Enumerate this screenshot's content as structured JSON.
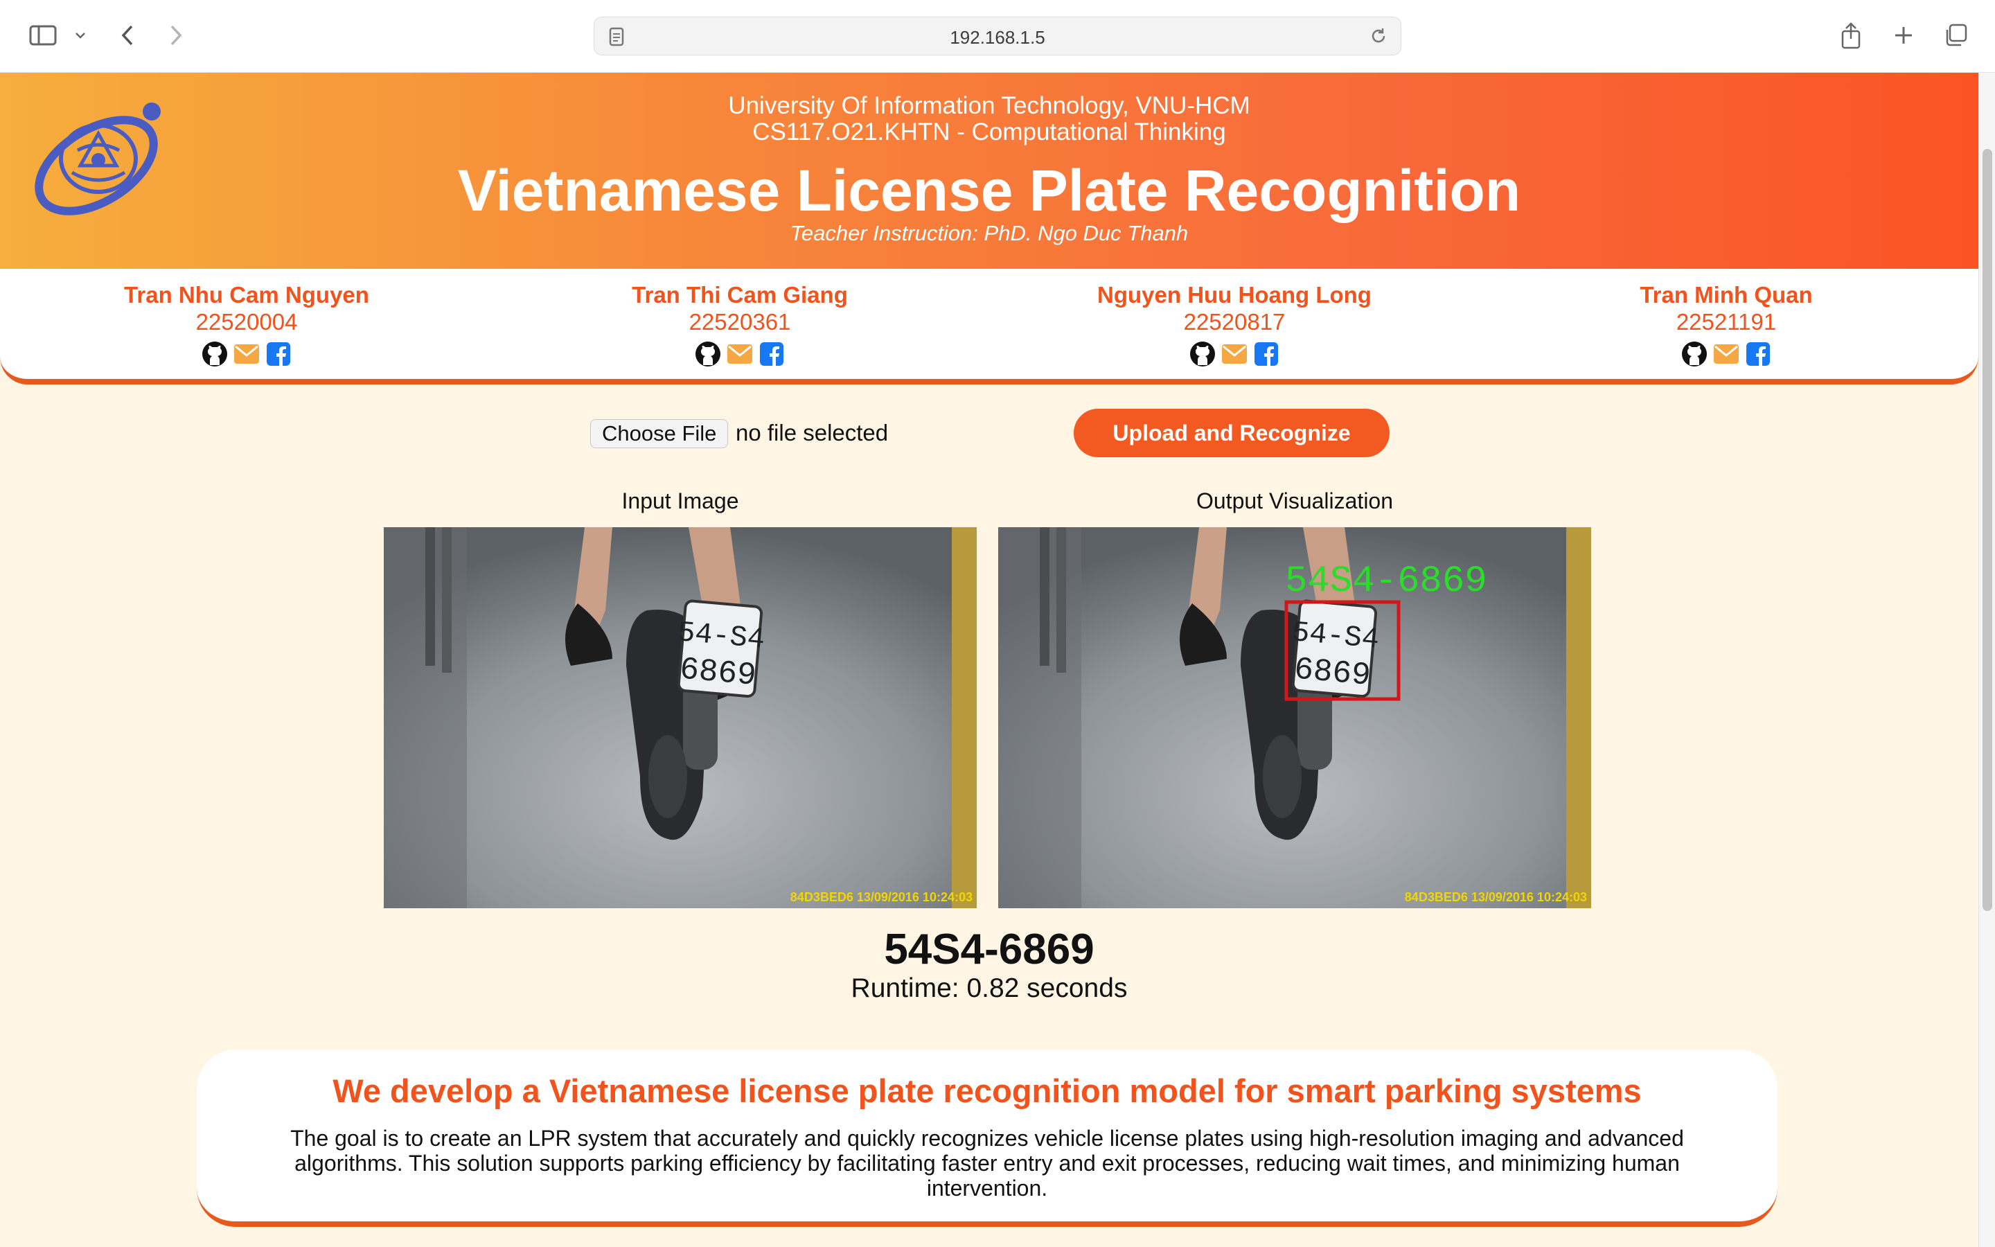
{
  "browser": {
    "url": "192.168.1.5"
  },
  "header": {
    "university": "University Of Information Technology, VNU-HCM",
    "course": "CS117.O21.KHTN - Computational Thinking",
    "title": "Vietnamese License Plate Recognition",
    "teacher": "Teacher Instruction: PhD. Ngo Duc Thanh"
  },
  "members": [
    {
      "name": "Tran Nhu Cam Nguyen",
      "id": "22520004"
    },
    {
      "name": "Tran Thi Cam Giang",
      "id": "22520361"
    },
    {
      "name": "Nguyen Huu Hoang Long",
      "id": "22520817"
    },
    {
      "name": "Tran Minh Quan",
      "id": "22521191"
    }
  ],
  "upload": {
    "choose_label": "Choose File",
    "file_status": "no file selected",
    "submit_label": "Upload and Recognize"
  },
  "images": {
    "input_label": "Input Image",
    "output_label": "Output Visualization",
    "plate_text": "54-S4\n6869",
    "detected_overlay": "54S4-6869",
    "timestamp_overlay": "84D3BED6  13/09/2016 10:24:03"
  },
  "result": {
    "plate": "54S4-6869",
    "runtime": "Runtime: 0.82 seconds"
  },
  "about": {
    "title": "We develop a Vietnamese license plate recognition model for smart parking systems",
    "text": "The goal is to create an LPR system that accurately and quickly recognizes vehicle license plates using high-resolution imaging and advanced algorithms. This solution supports parking efficiency by facilitating faster entry and exit processes, reducing wait times, and minimizing human intervention."
  },
  "colors": {
    "accent": "#f25a22",
    "background": "#fef5e5",
    "box": "#d01818",
    "overlay_text": "#2bdc2b"
  }
}
